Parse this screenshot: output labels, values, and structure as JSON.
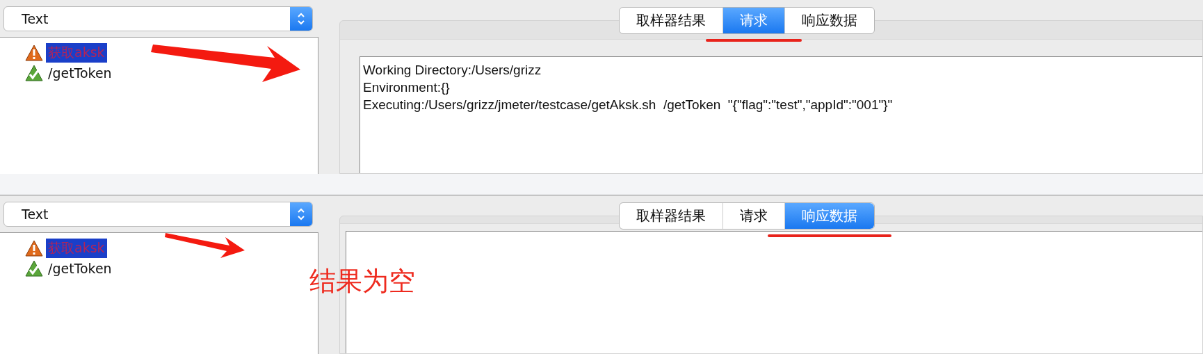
{
  "panels": [
    {
      "view_select": {
        "value": "Text"
      },
      "tree": [
        {
          "label": "获取aksk",
          "kind": "warning",
          "selected": true
        },
        {
          "label": "/getToken",
          "kind": "success",
          "selected": false
        }
      ],
      "tabs": [
        {
          "label": "取样器结果",
          "selected": false
        },
        {
          "label": "请求",
          "selected": true
        },
        {
          "label": "响应数据",
          "selected": false
        }
      ],
      "content": [
        "Working Directory:/Users/grizz",
        "Environment:{}",
        "Executing:/Users/grizz/jmeter/testcase/getAksk.sh  /getToken  \"{\"flag\":\"test\",\"appId\":\"001\"}\""
      ],
      "annotation": {
        "kind": "big-arrow"
      }
    },
    {
      "view_select": {
        "value": "Text"
      },
      "tree": [
        {
          "label": "获取aksk",
          "kind": "warning",
          "selected": true
        },
        {
          "label": "/getToken",
          "kind": "success",
          "selected": false
        }
      ],
      "tabs": [
        {
          "label": "取样器结果",
          "selected": false
        },
        {
          "label": "请求",
          "selected": false
        },
        {
          "label": "响应数据",
          "selected": true
        }
      ],
      "annotation": {
        "kind": "small-arrow",
        "text": "结果为空"
      }
    }
  ]
}
